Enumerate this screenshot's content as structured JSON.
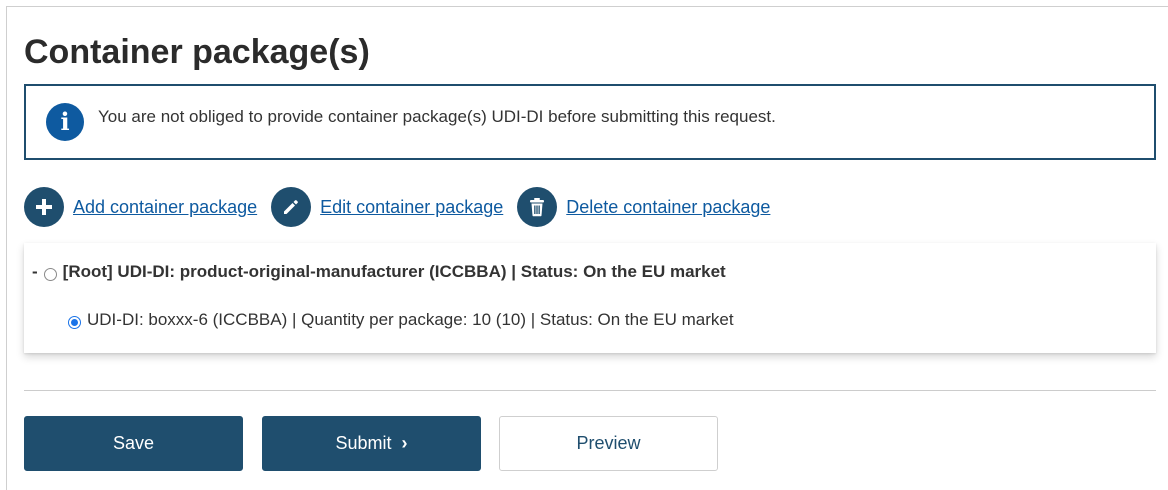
{
  "section": {
    "title": "Container package(s)"
  },
  "info_banner": {
    "icon": "info-icon",
    "text": "You are not obliged to provide container package(s) UDI-DI before submitting this request."
  },
  "actions": {
    "add": {
      "icon": "plus-icon",
      "label": "Add container package"
    },
    "edit": {
      "icon": "pencil-icon",
      "label": "Edit container package"
    },
    "delete": {
      "icon": "trash-icon",
      "label": "Delete container package"
    }
  },
  "tree": {
    "root": {
      "toggle": "-",
      "selected": false,
      "label": "[Root] UDI-DI: product-original-manufacturer (ICCBBA) | Status: On the EU market"
    },
    "children": [
      {
        "selected": true,
        "label": "UDI-DI: boxxx-6 (ICCBBA) | Quantity per package: 10 (10) | Status: On the EU market"
      }
    ]
  },
  "buttons": {
    "save": "Save",
    "submit": "Submit",
    "preview": "Preview"
  },
  "colors": {
    "primary": "#1f4e6e",
    "link": "#0e5aa0",
    "info_icon": "#0e5aa0",
    "radio_selected": "#1a73e8"
  }
}
